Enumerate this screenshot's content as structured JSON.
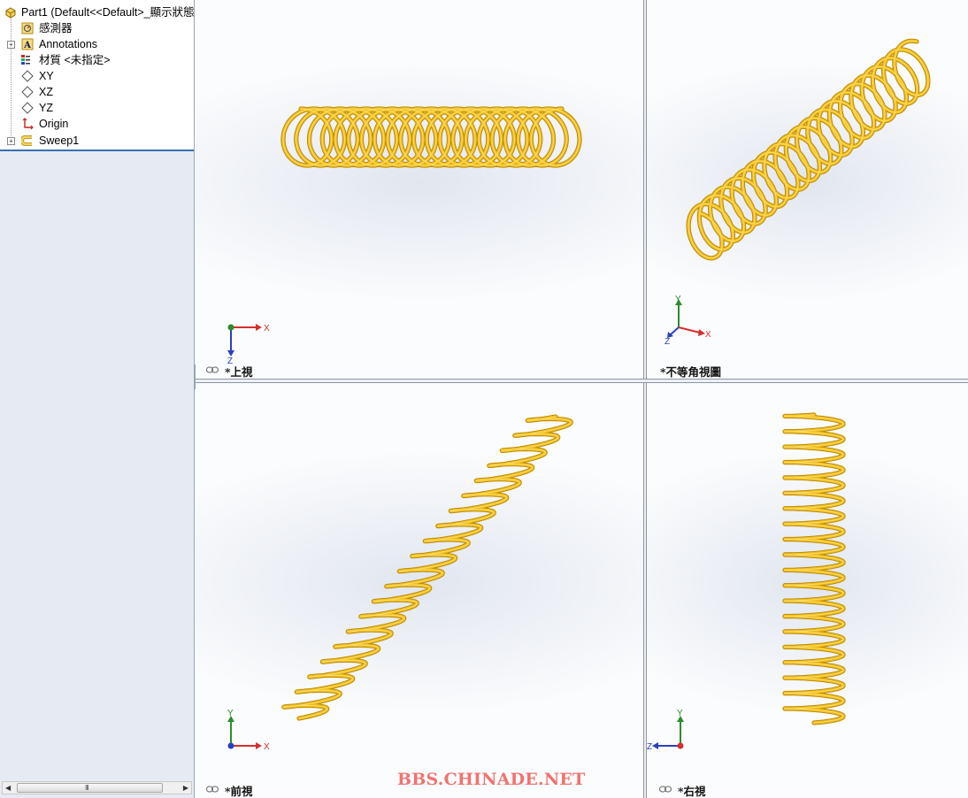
{
  "feature_tree": {
    "part": "Part1  (Default<<Default>_顯示狀態",
    "items": [
      {
        "label": "感測器",
        "icon": "sensor-icon"
      },
      {
        "label": "Annotations",
        "icon": "annotations-icon"
      },
      {
        "label": "材質 <未指定>",
        "icon": "material-icon"
      },
      {
        "label": "XY",
        "icon": "plane-icon"
      },
      {
        "label": "XZ",
        "icon": "plane-icon"
      },
      {
        "label": "YZ",
        "icon": "plane-icon"
      },
      {
        "label": "Origin",
        "icon": "origin-icon"
      },
      {
        "label": "Sweep1",
        "icon": "sweep-icon"
      }
    ],
    "scroll_grip": "III"
  },
  "viewports": {
    "top": {
      "label": "*上視",
      "axis": {
        "h": "X",
        "v": "Z"
      }
    },
    "iso": {
      "label": "*不等角視圖",
      "axis": {
        "v": "Y",
        "h": "X",
        "d": "Z"
      }
    },
    "front": {
      "label": "*前視",
      "axis": {
        "v": "Y",
        "h": "X"
      }
    },
    "right": {
      "label": "*右視",
      "axis": {
        "v": "Y",
        "h": "Z"
      }
    }
  },
  "watermark": "BBS.CHINADE.NET",
  "colors": {
    "spring": "#f2be1c",
    "spring_edge": "#b98500",
    "axis_x": "#d62f2f",
    "axis_y": "#2e8b2e",
    "axis_z": "#2a3fbf"
  }
}
